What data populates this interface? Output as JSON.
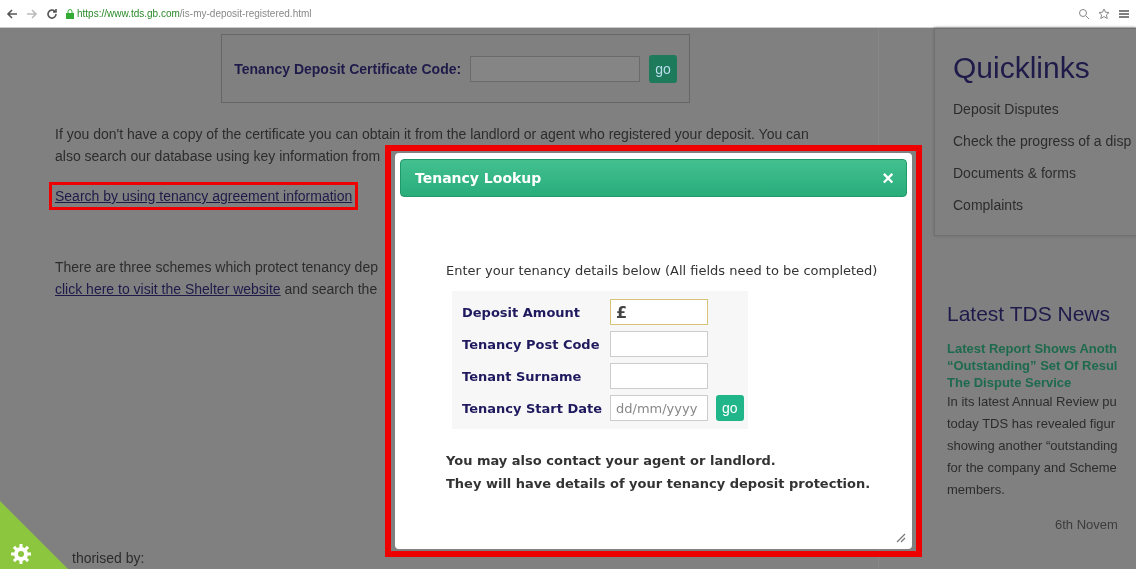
{
  "browser": {
    "url_host": "https://www.tds.gb.com",
    "url_path": "/is-my-deposit-registered.html"
  },
  "certificate": {
    "label": "Tenancy Deposit Certificate Code:",
    "button": "go"
  },
  "intro_lines": [
    "If you don't have a copy of the certificate you can obtain it from the landlord or agent who registered your deposit. You can",
    "also search our database using key information from"
  ],
  "search_link": {
    "label": "Search by using tenancy agreement information",
    "highlighted": true
  },
  "schemes_text": "There are three schemes which protect tenancy dep",
  "shelter": {
    "link": "click here to visit the Shelter website",
    "after": "and search the"
  },
  "footer_text": "thorised by:",
  "quicklinks": {
    "title": "Quicklinks",
    "items": [
      "Deposit Disputes",
      "Check the progress of a disp",
      "Documents & forms",
      "Complaints"
    ]
  },
  "news": {
    "title": "Latest TDS News",
    "headline_lines": [
      "Latest Report Shows Anoth",
      "“Outstanding” Set Of Resul",
      "The Dispute Service"
    ],
    "body_lines": [
      "In its latest Annual Review pu",
      "today TDS has revealed figur",
      "showing another “outstanding",
      "for the company and Scheme",
      "members."
    ],
    "date": "6th Novem"
  },
  "modal": {
    "title": "Tenancy Lookup",
    "close": "×",
    "highlighted": true,
    "instructions": "Enter your tenancy details below (All fields need to be completed)",
    "fields": [
      {
        "label": "Deposit Amount",
        "value": "£",
        "focused": true
      },
      {
        "label": "Tenancy Post Code",
        "focused": false
      },
      {
        "label": "Tenant Surname",
        "focused": false
      },
      {
        "label": "Tenancy Start Date",
        "placeholder": "dd/mm/yyyy",
        "focused": false
      }
    ],
    "submit": "go",
    "note_lines": [
      "You may also contact your agent or landlord.",
      "They will have details of your tenancy deposit protection."
    ]
  }
}
